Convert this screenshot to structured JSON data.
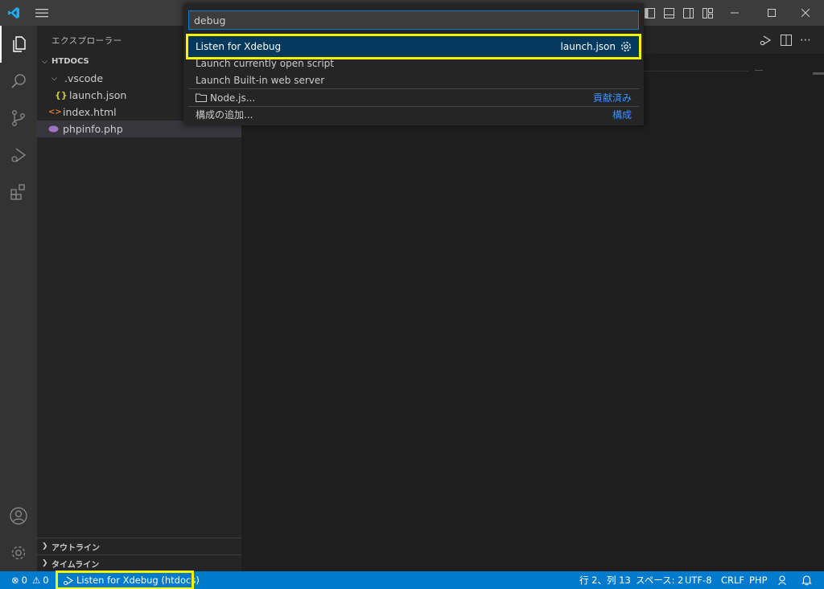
{
  "sidebar": {
    "title": "エクスプローラー",
    "folder": "HTDOCS",
    "items": [
      {
        "label": ".vscode"
      },
      {
        "label": "launch.json"
      },
      {
        "label": "index.html"
      },
      {
        "label": "phpinfo.php"
      }
    ],
    "sections": [
      {
        "label": "アウトライン"
      },
      {
        "label": "タイムライン"
      }
    ]
  },
  "quickpick": {
    "input_value": "debug",
    "items": [
      {
        "label": "Listen for Xdebug",
        "right": "launch.json",
        "active": true
      },
      {
        "label": "Launch currently open script",
        "right": ""
      },
      {
        "label": "Launch Built-in web server",
        "right": ""
      },
      {
        "label": "Node.js...",
        "right": "貢献済み"
      },
      {
        "label": "構成の追加...",
        "right": "構成"
      }
    ]
  },
  "statusbar": {
    "errors": "0",
    "warnings": "0",
    "debug_config": "Listen for Xdebug (htdocs)",
    "position": "行 2、列 13",
    "spaces": "スペース: 2",
    "encoding": "UTF-8",
    "eol": "CRLF",
    "language": "PHP"
  },
  "colors": {
    "accent": "#007acc",
    "highlight": "#f5f500",
    "selection": "#04395e"
  }
}
